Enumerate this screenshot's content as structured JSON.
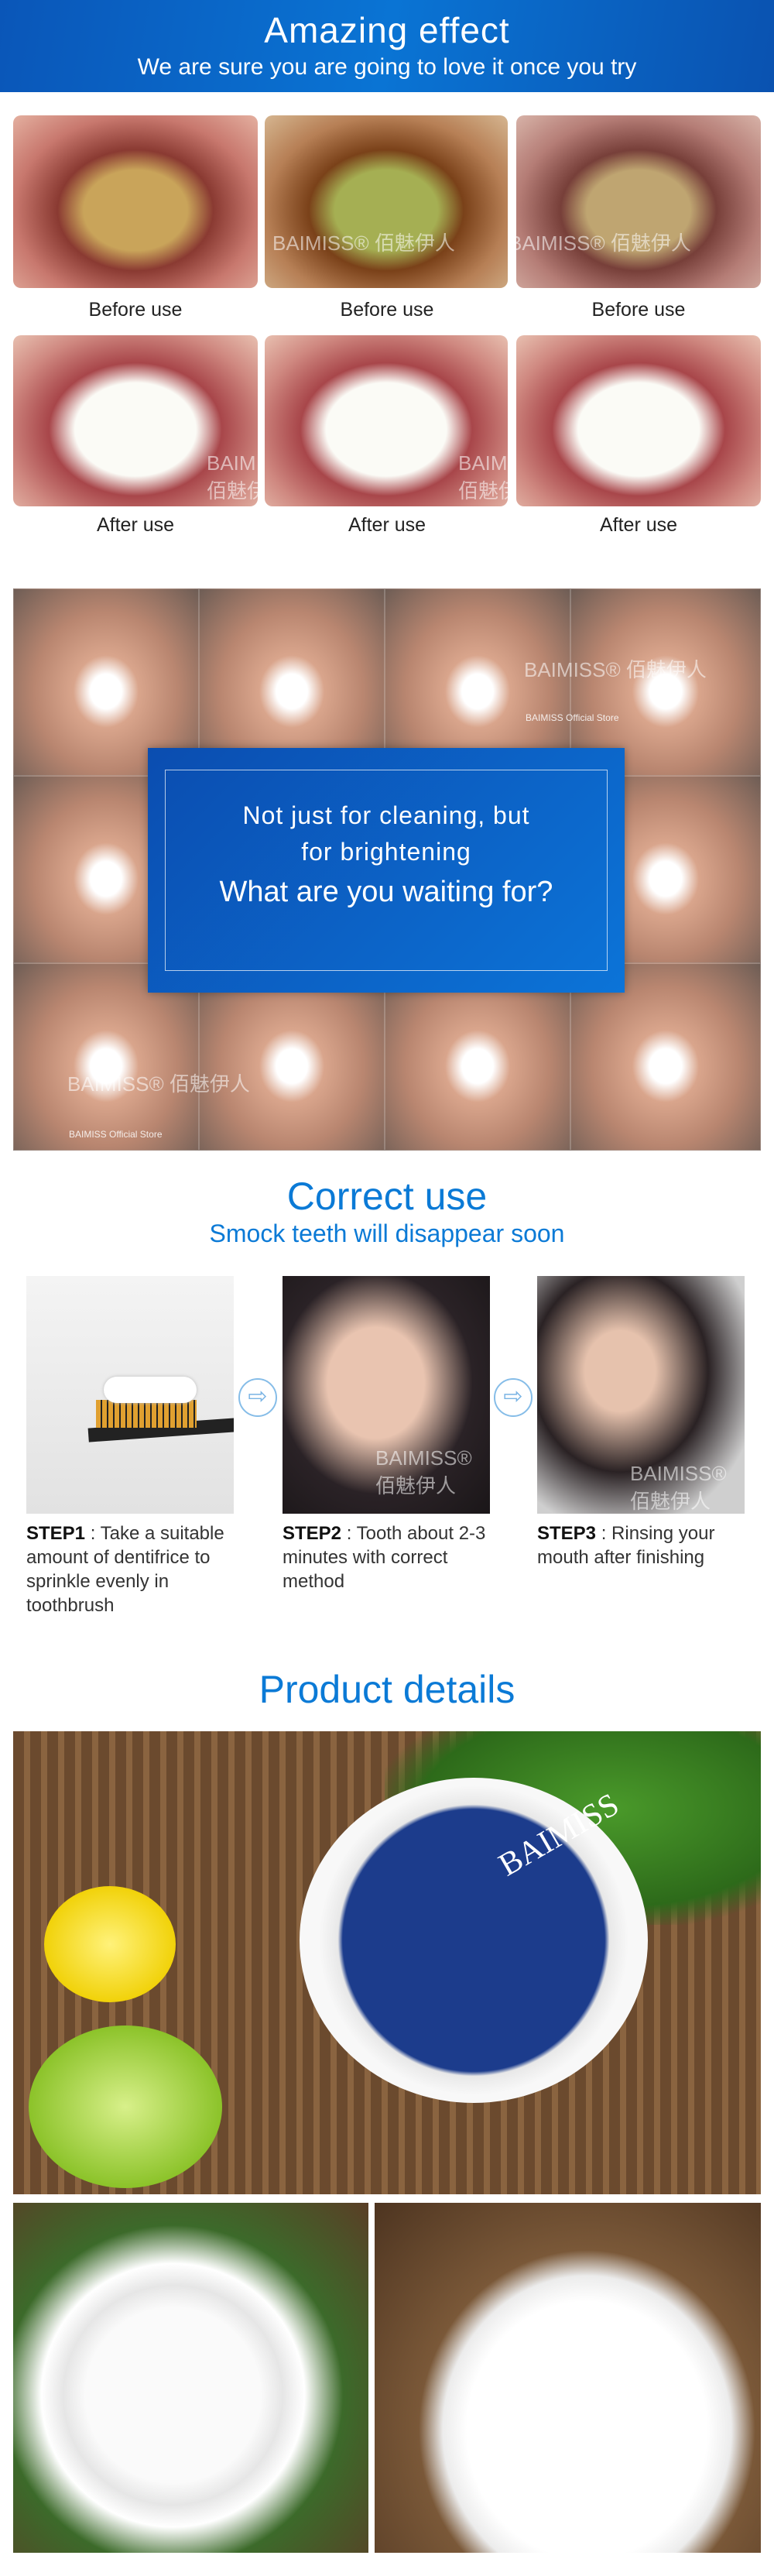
{
  "banner": {
    "title": "Amazing effect",
    "subtitle": "We are sure you are going to love it once you try"
  },
  "comparison": {
    "before_label": "Before use",
    "after_label": "After use",
    "watermark": "BAIMISS® 佰魅伊人"
  },
  "collage": {
    "line1": "Not just for cleaning, but",
    "line2": "for brightening",
    "line3": "What are you waiting for?",
    "watermark": "BAIMISS® 佰魅伊人",
    "store": "BAIMISS Official Store"
  },
  "correct_use": {
    "title": "Correct use",
    "subtitle": "Smock teeth will disappear soon",
    "steps": [
      {
        "label": "STEP1",
        "text": " : Take a suitable amount of dentifrice to sprinkle evenly in toothbrush"
      },
      {
        "label": "STEP2",
        "text": " : Tooth about 2-3 minutes with correct method"
      },
      {
        "label": "STEP3",
        "text": " : Rinsing your mouth after finishing"
      }
    ]
  },
  "product": {
    "title": "Product details",
    "brand": "BAIMISS"
  },
  "colors": {
    "accent": "#0b7ad6",
    "banner": "#0a62c4"
  }
}
